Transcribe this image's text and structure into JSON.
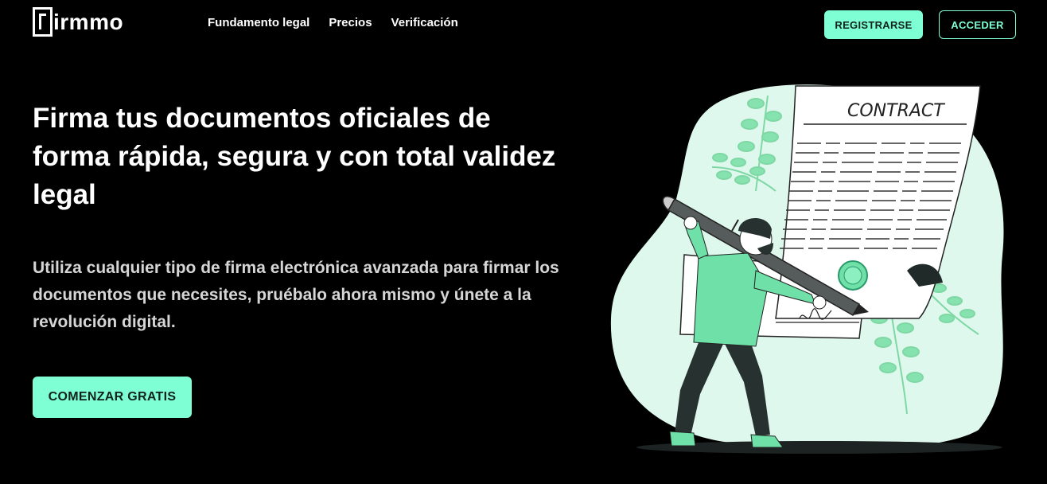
{
  "brand": {
    "name": "irmmo"
  },
  "nav": {
    "links": [
      "Fundamento legal",
      "Precios",
      "Verificación"
    ],
    "register_label": "REGISTRARSE",
    "login_label": "ACCEDER"
  },
  "hero": {
    "title": "Firma tus documentos oficiales de forma rápida, segura y con total validez legal",
    "subtitle": "Utiliza cualquier tipo de firma electrónica avanzada para firmar los documentos que necesites, pruébalo ahora mismo y únete a la revolución digital.",
    "cta_label": "COMENZAR GRATIS"
  },
  "illustration": {
    "document_title": "CONTRACT"
  },
  "colors": {
    "accent": "#7fffd4",
    "background": "#000000",
    "figure_green": "#6fe0a8",
    "blob": "#dff8ee"
  }
}
